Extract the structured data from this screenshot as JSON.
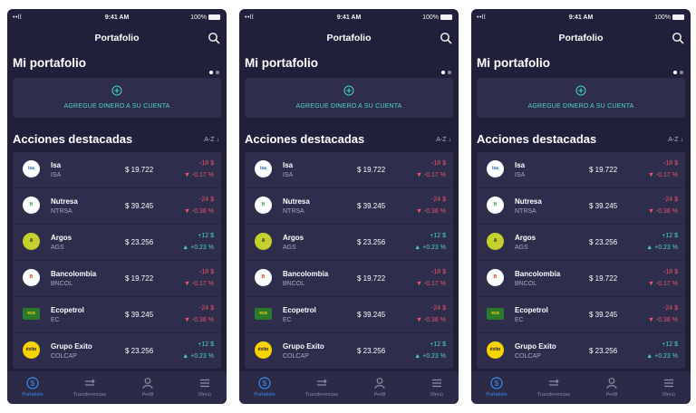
{
  "status": {
    "signal": "••ll",
    "time": "9:41 AM",
    "battery": "100%"
  },
  "header": {
    "title": "Portafolio",
    "search_icon": "search-icon"
  },
  "portfolio": {
    "title": "Mi portafolio",
    "add_label": "AGREGUE DINERO A SU CUENTA",
    "add_icon": "plus-circle-icon"
  },
  "featured": {
    "title": "Acciones destacadas",
    "sort_label": "A-Z ↓"
  },
  "stocks": [
    {
      "name": "Isa",
      "ticker": "ISA",
      "price": "$ 19.722",
      "change": "-18 $",
      "pct": "▼ -0.17 %",
      "dir": "neg",
      "logo_text": "isa",
      "logo_bg": "#ffffff",
      "logo_fg": "#1f6fc2",
      "logo_shape": "circle"
    },
    {
      "name": "Nutresa",
      "ticker": "NTRSA",
      "price": "$ 39.245",
      "change": "-24 $",
      "pct": "▼ -0.36 %",
      "dir": "neg",
      "logo_text": "N",
      "logo_bg": "#ffffff",
      "logo_fg": "#3a9b4a",
      "logo_shape": "circle"
    },
    {
      "name": "Argos",
      "ticker": "AGS",
      "price": "$ 23.256",
      "change": "+12 $",
      "pct": "▲ +0.23 %",
      "dir": "pos",
      "logo_text": "A",
      "logo_bg": "#c6d22c",
      "logo_fg": "#1d1c33",
      "logo_shape": "circle"
    },
    {
      "name": "Bancolombia",
      "ticker": "BNCOL",
      "price": "$ 19.722",
      "change": "-18 $",
      "pct": "▼ -0.17 %",
      "dir": "neg",
      "logo_text": "B",
      "logo_bg": "#ffffff",
      "logo_fg": "#e23a2e",
      "logo_shape": "circle"
    },
    {
      "name": "Ecopetrol",
      "ticker": "EC",
      "price": "$ 39.245",
      "change": "-24 $",
      "pct": "▼ -0.36 %",
      "dir": "neg",
      "logo_text": "eco",
      "logo_bg": "#2a7a2a",
      "logo_fg": "#f4d21c",
      "logo_shape": "rect"
    },
    {
      "name": "Grupo Exito",
      "ticker": "COLCAP",
      "price": "$ 23.256",
      "change": "+12 $",
      "pct": "▲ +0.23 %",
      "dir": "pos",
      "logo_text": "éxito",
      "logo_bg": "#f7d600",
      "logo_fg": "#1d1c33",
      "logo_shape": "circle"
    }
  ],
  "tabs": [
    {
      "label": "Portafolio",
      "icon": "dollar-icon",
      "active": true
    },
    {
      "label": "Transferencias",
      "icon": "transfer-icon",
      "active": false
    },
    {
      "label": "Perfil",
      "icon": "user-icon",
      "active": false
    },
    {
      "label": "Menú",
      "icon": "menu-icon",
      "active": false
    }
  ],
  "colors": {
    "background": "#21203a",
    "card": "#2e2d4b",
    "accent": "#4ed6c8",
    "negative": "#ee5770",
    "active_tab": "#3f8ff0"
  }
}
